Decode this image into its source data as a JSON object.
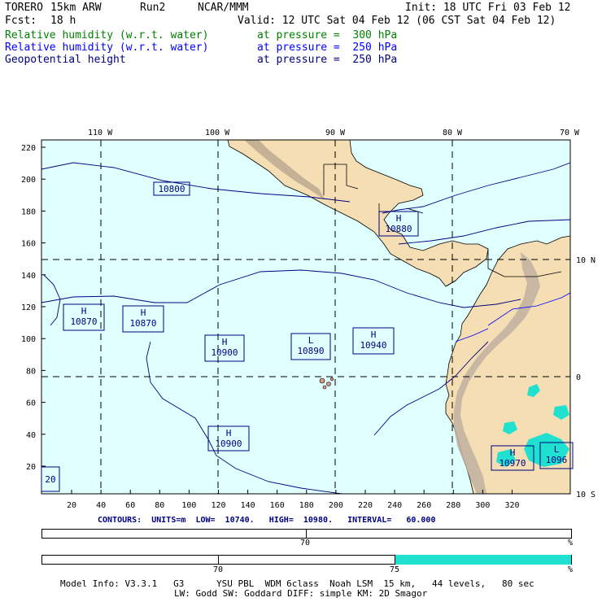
{
  "header": {
    "model": "TORERO",
    "resolution": "15km ARW",
    "run": "Run2",
    "org": "NCAR/MMM",
    "init": "Init: 18 UTC Fri 03 Feb 12",
    "fcst_label": "Fcst:",
    "fcst_value": "18 h",
    "valid": "Valid: 12 UTC Sat 04 Feb 12 (06 CST Sat 04 Feb 12)",
    "fields": [
      {
        "name": "Relative humidity (w.r.t. water)",
        "level": "at pressure =  300 hPa",
        "color": "#008000"
      },
      {
        "name": "Relative humidity (w.r.t. water)",
        "level": "at pressure =  250 hPa",
        "color": "#0000ff"
      },
      {
        "name": "Geopotential height",
        "level": "at pressure =  250 hPa",
        "color": "#000080"
      }
    ]
  },
  "map": {
    "top_lon_labels": [
      "110 W",
      "100 W",
      "90 W",
      "80 W",
      "70 W"
    ],
    "right_lat_labels": [
      "10 N",
      "0",
      "10 S"
    ],
    "left_ticks": [
      "220",
      "200",
      "180",
      "160",
      "140",
      "120",
      "100",
      "80",
      "60",
      "40",
      "20"
    ],
    "bottom_ticks": [
      "20",
      "40",
      "60",
      "80",
      "100",
      "120",
      "140",
      "160",
      "180",
      "200",
      "220",
      "240",
      "260",
      "280",
      "300",
      "320"
    ],
    "contour_labels": [
      {
        "text": "10800",
        "type": "label"
      },
      {
        "text": "10880",
        "type": "H"
      },
      {
        "text": "10870",
        "type": "H"
      },
      {
        "text": "10870",
        "type": "H"
      },
      {
        "text": "10900",
        "type": "H"
      },
      {
        "text": "10890",
        "type": "L"
      },
      {
        "text": "10940",
        "type": "H"
      },
      {
        "text": "10900",
        "type": "H"
      },
      {
        "text": "10970",
        "type": "H"
      },
      {
        "text": "1096",
        "type": "L"
      },
      {
        "text": "20",
        "type": "label"
      }
    ],
    "colors": {
      "ocean": "#e0ffff",
      "land": "#f5deb3",
      "relief": "#b0a08a",
      "humidity": "#20e0d0",
      "contour": "#000080"
    }
  },
  "contours_line": {
    "label": "CONTOURS:",
    "units": "UNITS=m",
    "low": "LOW=  10740.",
    "high": "HIGH=  10980.",
    "interval": "INTERVAL=   60.000"
  },
  "colorbars": [
    {
      "ticks": [
        "70"
      ],
      "unit": "%",
      "fill_from": null
    },
    {
      "ticks": [
        "70",
        "75"
      ],
      "unit": "%",
      "fill_from": 75,
      "fill_color": "#20e0d0"
    }
  ],
  "footer": {
    "line1": "Model Info: V3.3.1   G3      YSU PBL  WDM 6class  Noah LSM  15 km,   44 levels,   80 sec",
    "line2": "LW: Godd SW: Goddard DIFF: simple KM: 2D Smagor"
  }
}
